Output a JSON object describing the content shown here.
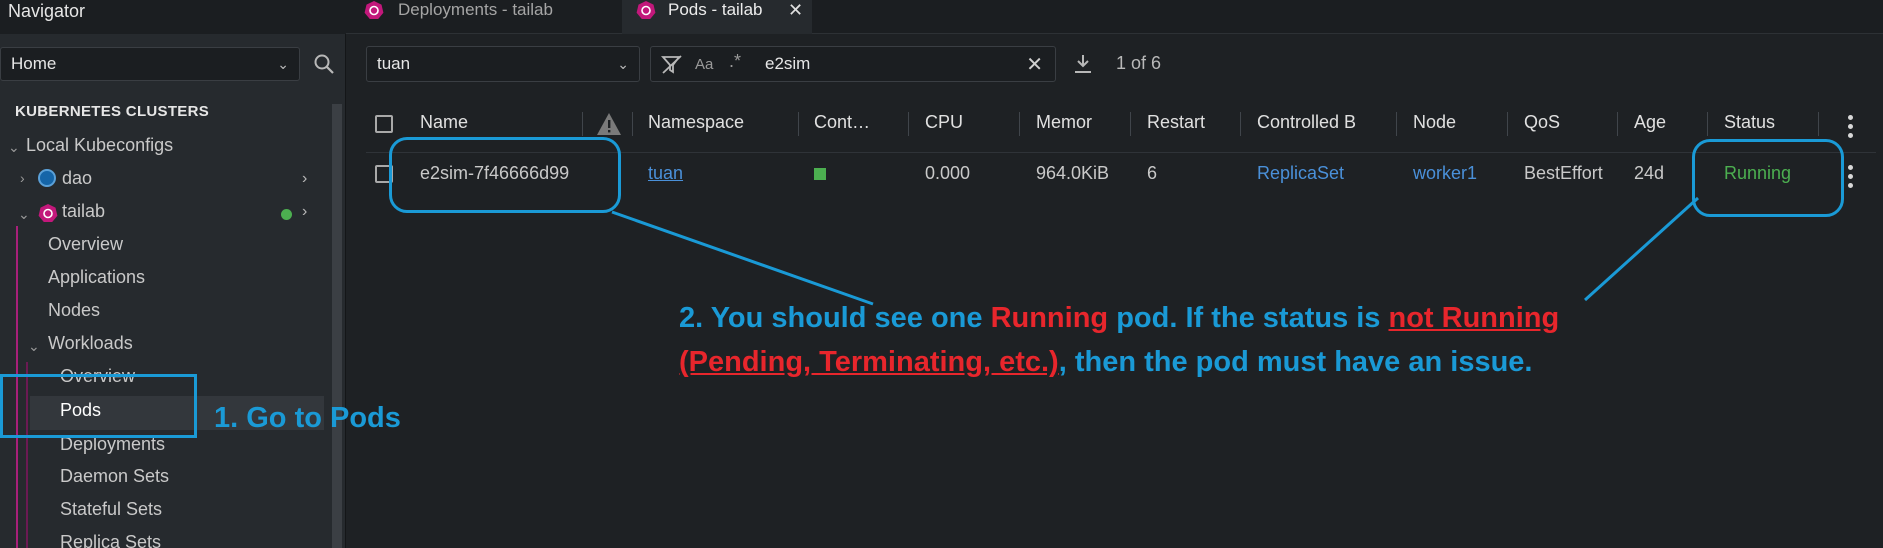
{
  "sidebar": {
    "header": "Navigator",
    "home_select": "Home",
    "section_title": "KUBERNETES CLUSTERS",
    "tree": {
      "local_kubeconfigs": "Local Kubeconfigs",
      "dao": "dao",
      "tailab": "tailab",
      "overview": "Overview",
      "applications": "Applications",
      "nodes": "Nodes",
      "workloads": "Workloads",
      "workloads_overview": "Overview",
      "pods": "Pods",
      "deployments": "Deployments",
      "daemon_sets": "Daemon Sets",
      "stateful_sets": "Stateful Sets",
      "replica_sets": "Replica Sets"
    }
  },
  "tabs": [
    {
      "label": "Deployments - tailab"
    },
    {
      "label": "Pods - tailab"
    }
  ],
  "toolbar": {
    "namespace": "tuan",
    "regex_case_label": "Aa",
    "search_value": "e2sim",
    "count_text": "1 of 6"
  },
  "table": {
    "headers": {
      "name": "Name",
      "namespace": "Namespace",
      "containers": "Cont…",
      "cpu": "CPU",
      "memory": "Memor",
      "restarts": "Restart",
      "controlled_by": "Controlled B",
      "node": "Node",
      "qos": "QoS",
      "age": "Age",
      "status": "Status"
    },
    "row": {
      "name": "e2sim-7f46666d99",
      "namespace": "tuan",
      "cpu": "0.000",
      "memory": "964.0KiB",
      "restarts": "6",
      "controlled_by": "ReplicaSet",
      "node": "worker1",
      "qos": "BestEffort",
      "age": "24d",
      "status": "Running"
    }
  },
  "annotations": {
    "step1": "1. Go to Pods",
    "step2": {
      "a": "2. You should see one ",
      "b": "Running",
      "c": " pod. If the status is ",
      "d": "not Running",
      "e": "(Pending, Terminating, etc.)",
      "f": ", then the pod must have an issue."
    }
  },
  "colors": {
    "accent_blue": "#1a9ad6",
    "annotation_red": "#e8262c",
    "running_green": "#4caf50",
    "link_blue": "#4a90d9",
    "k8s_magenta": "#c2187b"
  }
}
